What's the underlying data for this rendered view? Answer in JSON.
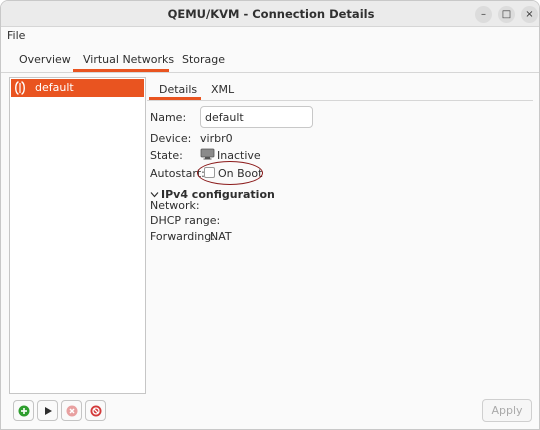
{
  "window": {
    "title": "QEMU/KVM - Connection Details",
    "controls": {
      "minimize": "–",
      "maximize": "□",
      "close": "×"
    }
  },
  "menubar": {
    "file": "File"
  },
  "tabs": [
    {
      "label": "Overview",
      "active": false
    },
    {
      "label": "Virtual Networks",
      "active": true
    },
    {
      "label": "Storage",
      "active": false
    }
  ],
  "networks": [
    {
      "name": "default",
      "icon": "network-icon",
      "selected": true
    }
  ],
  "toolbar": {
    "add_icon": "add-network-icon",
    "start_icon": "start-icon",
    "stop_icon": "stop-icon",
    "delete_icon": "delete-icon"
  },
  "subtabs": [
    {
      "label": "Details",
      "active": true
    },
    {
      "label": "XML",
      "active": false
    }
  ],
  "details": {
    "name_label": "Name:",
    "name_value": "default",
    "device_label": "Device:",
    "device_value": "virbr0",
    "state_label": "State:",
    "state_value": "Inactive",
    "autostart_label": "Autostart:",
    "autostart_option": "On Boot",
    "autostart_checked": false
  },
  "ipv4": {
    "title": "IPv4 configuration",
    "network_label": "Network:",
    "dhcp_label": "DHCP range:",
    "forwarding_label": "Forwarding:",
    "forwarding_value": "NAT"
  },
  "apply_button": {
    "label": "Apply",
    "enabled": false
  },
  "colors": {
    "accent": "#e95420",
    "add_green": "#2e9e2e",
    "stop_red": "#d33a3a",
    "annotation": "#8b1a1a"
  }
}
